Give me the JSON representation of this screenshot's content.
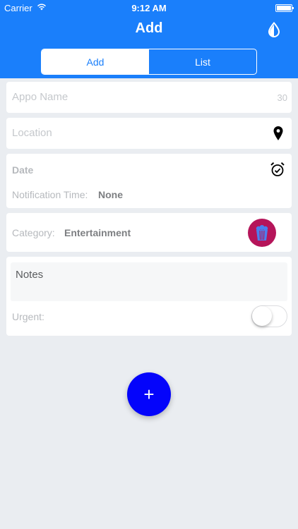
{
  "status": {
    "carrier": "Carrier",
    "time": "9:12 AM"
  },
  "nav": {
    "title": "Add",
    "theme_icon": "drop-half-icon"
  },
  "segments": {
    "add": "Add",
    "list": "List"
  },
  "form": {
    "name_placeholder": "Appo Name",
    "name_counter": "30",
    "location_placeholder": "Location",
    "date_label": "Date",
    "notif_label": "Notification Time:",
    "notif_value": "None",
    "category_label": "Category:",
    "category_value": "Entertainment",
    "category_icon": "popcorn-icon",
    "notes_placeholder": "Notes",
    "urgent_label": "Urgent:",
    "urgent_on": false
  },
  "fab": {
    "symbol": "+"
  },
  "colors": {
    "primary": "#1a7ffb",
    "fab": "#0404fb",
    "category_badge": "#b5155a",
    "background": "#eaedf1"
  }
}
